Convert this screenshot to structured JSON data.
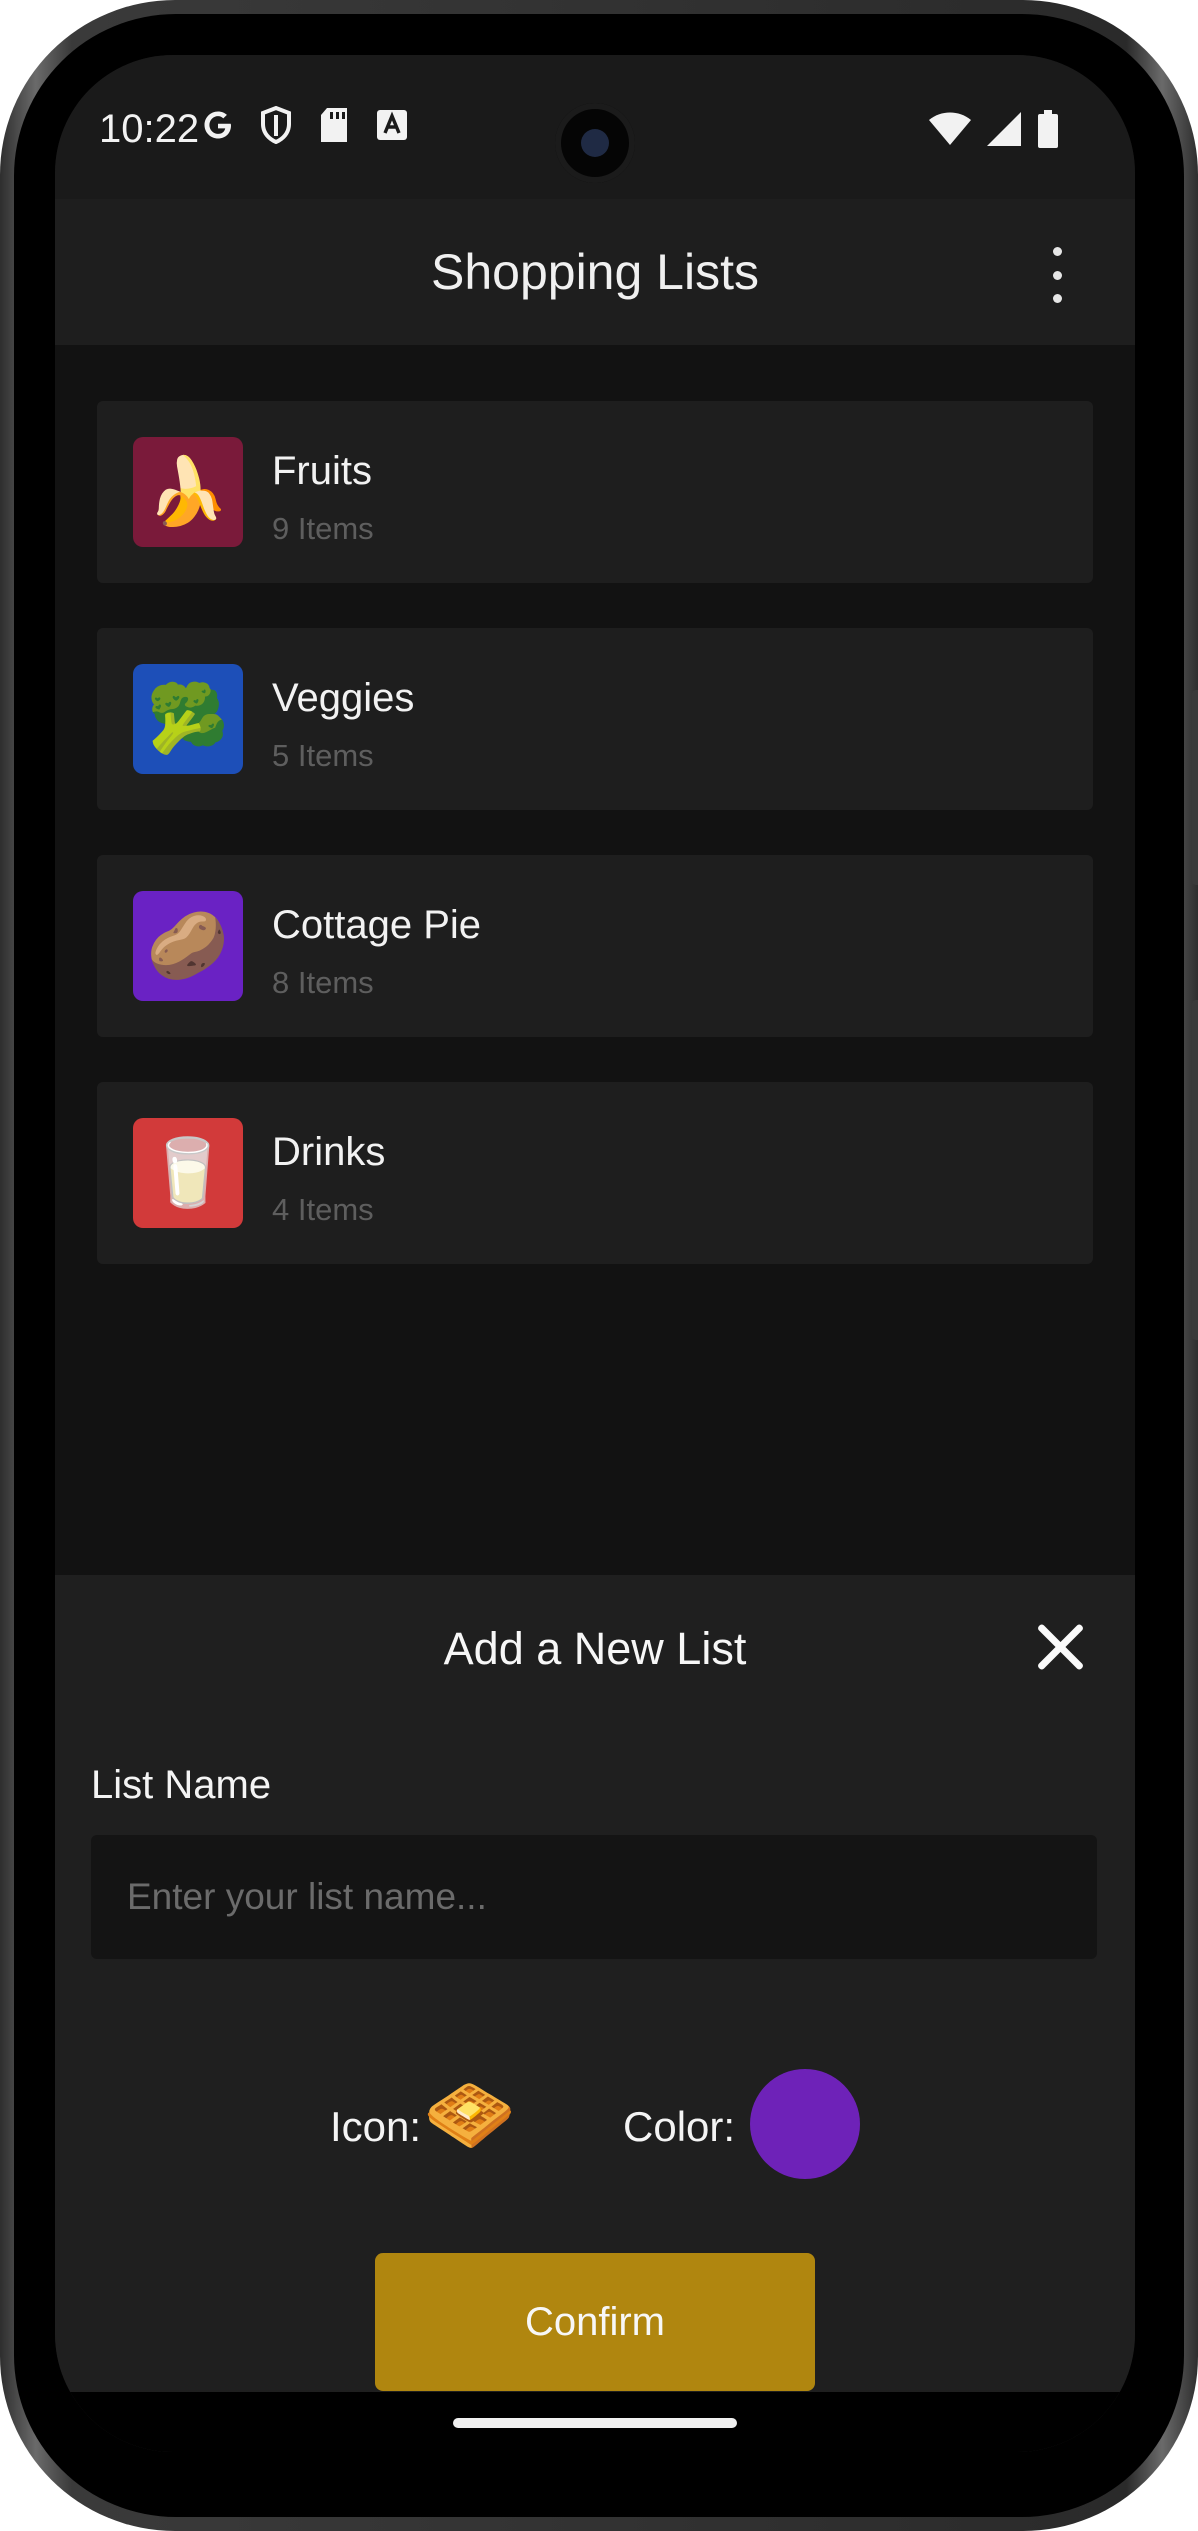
{
  "status_bar": {
    "time": "10:22",
    "left_icons": [
      "google-icon",
      "shield-icon",
      "sd-card-icon",
      "text-a-icon"
    ],
    "right_icons": [
      "wifi-icon",
      "signal-icon",
      "battery-icon"
    ]
  },
  "app_bar": {
    "title": "Shopping Lists",
    "menu_icon": "more-vert-icon"
  },
  "lists": [
    {
      "name": "Fruits",
      "count": "9 Items",
      "emoji": "🍌",
      "color": "#7a1a3a"
    },
    {
      "name": "Veggies",
      "count": "5 Items",
      "emoji": "🥦",
      "color": "#1d4fb8"
    },
    {
      "name": "Cottage Pie",
      "count": "8 Items",
      "emoji": "🥔",
      "color": "#6a22c4"
    },
    {
      "name": "Drinks",
      "count": "4 Items",
      "emoji": "🥛",
      "color": "#d23a3a"
    }
  ],
  "sheet": {
    "title": "Add a New List",
    "close_icon": "close-icon",
    "name_label": "List Name",
    "name_placeholder": "Enter your list name...",
    "name_value": "",
    "icon_label": "Icon:",
    "icon_emoji": "🧇",
    "color_label": "Color:",
    "selected_color": "#6e22b8",
    "confirm_label": "Confirm",
    "confirm_color": "#b0860f"
  }
}
